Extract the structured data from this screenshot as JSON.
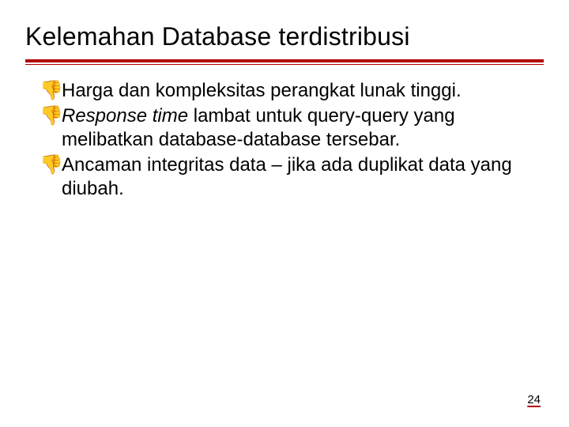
{
  "title": "Kelemahan Database terdistribusi",
  "bullets": {
    "b1": "Harga dan kompleksitas perangkat lunak tinggi.",
    "b2_italic": "Response time",
    "b2_rest": " lambat untuk query-query yang melibatkan database-database tersebar.",
    "b3": "Ancaman integritas data – jika ada duplikat data yang diubah."
  },
  "icons": {
    "thumbs_down": "👎"
  },
  "page_number": "24"
}
